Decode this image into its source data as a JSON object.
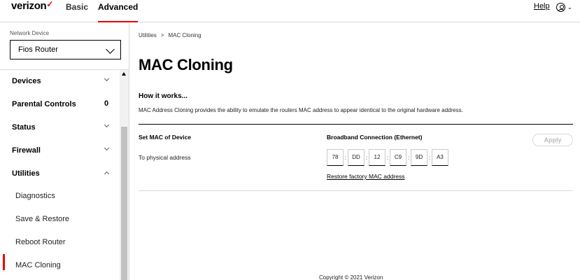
{
  "header": {
    "logo": "verizon",
    "logo_check": "✓",
    "tabs": [
      {
        "label": "Basic"
      },
      {
        "label": "Advanced"
      }
    ],
    "help_label": "Help"
  },
  "sidebar": {
    "network_device_label": "Network Device",
    "network_device_value": "Fios Router",
    "items": [
      {
        "label": "Devices"
      },
      {
        "label": "Parental Controls",
        "count": "0"
      },
      {
        "label": "Status"
      },
      {
        "label": "Firewall"
      },
      {
        "label": "Utilities"
      }
    ],
    "subitems": [
      {
        "label": "Diagnostics"
      },
      {
        "label": "Save & Restore"
      },
      {
        "label": "Reboot Router"
      },
      {
        "label": "MAC Cloning"
      }
    ]
  },
  "breadcrumb": {
    "parent": "Utilities",
    "separator": ">",
    "current": "MAC Cloning"
  },
  "main": {
    "title": "MAC Cloning",
    "how_heading": "How it works...",
    "description": "MAC Address Cloning provides the ability to emulate the routers MAC address to appear identical to the original hardware address.",
    "set_mac_label": "Set MAC of Device",
    "physical_label": "To physical address",
    "connection_label": "Broadband Connection (Ethernet)",
    "apply_label": "Apply",
    "mac_octets": [
      "78",
      "DD",
      "12",
      "C9",
      "9D",
      "A3"
    ],
    "colon": ":",
    "restore_label": "Restore factory MAC address"
  },
  "footer": {
    "copyright": "Copyright © 2021 Verizon"
  },
  "colors": {
    "accent": "#ee0000",
    "divider": "#d8dada"
  }
}
